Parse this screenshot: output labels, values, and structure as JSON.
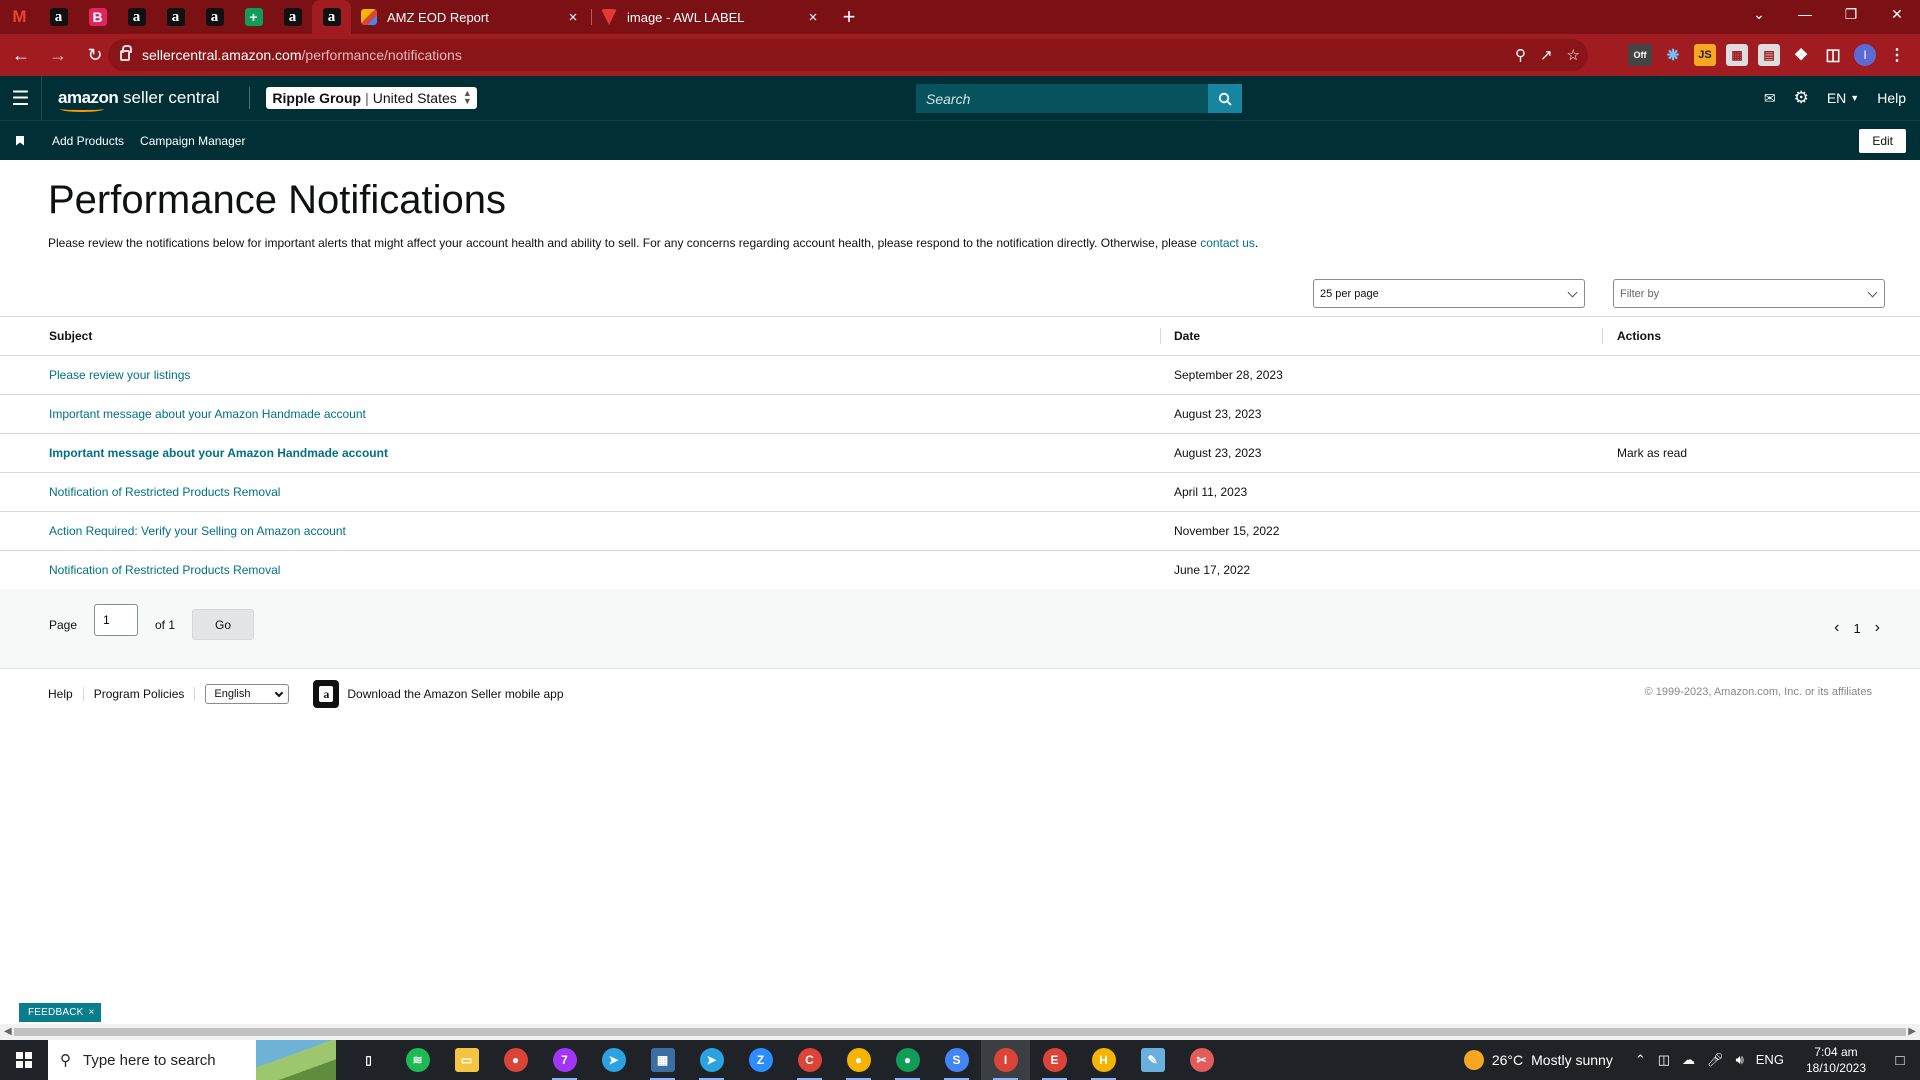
{
  "browser": {
    "pinned_tabs": [
      {
        "icon": "gmail-icon",
        "glyph": "M"
      },
      {
        "icon": "amazon-icon",
        "glyph": "a"
      },
      {
        "icon": "bold-b-icon",
        "glyph": "B"
      },
      {
        "icon": "amazon-icon",
        "glyph": "a"
      },
      {
        "icon": "amazon-icon",
        "glyph": "a"
      },
      {
        "icon": "amazon-icon",
        "glyph": "a"
      },
      {
        "icon": "sheets-icon",
        "glyph": "+"
      },
      {
        "icon": "amazon-icon",
        "glyph": "a"
      },
      {
        "icon": "amazon-icon",
        "glyph": "a"
      }
    ],
    "tabs": [
      {
        "title": "AMZ EOD Report",
        "icon": "report-icon"
      },
      {
        "title": "image - AWL LABEL",
        "icon": "awl-icon"
      }
    ],
    "url_domain": "sellercentral.amazon.com",
    "url_path": "/performance/notifications",
    "profile_initial": "I",
    "extension_off_badge": "Off",
    "extension_js": "JS",
    "colors": {
      "tab_strip": "#7b1114",
      "toolbar": "#a01c20"
    }
  },
  "header": {
    "logo_bold": "amazon",
    "logo_rest": " seller central",
    "account_name": "Ripple Group",
    "account_marketplace": "United States",
    "search_placeholder": "Search",
    "language": "EN",
    "help": "Help",
    "colors": {
      "bar": "#002f36",
      "search_button": "#1785a0"
    }
  },
  "bookmarks": {
    "links": [
      "Add Products",
      "Campaign Manager"
    ],
    "edit": "Edit"
  },
  "page": {
    "title": "Performance Notifications",
    "intro": "Please review the notifications below for important alerts that might affect your account health and ability to sell. For any concerns regarding account health, please respond to the notification directly. Otherwise, please ",
    "intro_link": "contact us",
    "intro_end": ".",
    "per_page": "25 per page",
    "filter_placeholder": "Filter by"
  },
  "table": {
    "headers": {
      "subject": "Subject",
      "date": "Date",
      "actions": "Actions"
    },
    "rows": [
      {
        "subject": "Please review your listings",
        "date": "September 28, 2023",
        "action": "",
        "unread": false
      },
      {
        "subject": "Important message about your Amazon Handmade account",
        "date": "August 23, 2023",
        "action": "",
        "unread": false
      },
      {
        "subject": "Important message about your Amazon Handmade account",
        "date": "August 23, 2023",
        "action": "Mark as read",
        "unread": true
      },
      {
        "subject": "Notification of Restricted Products Removal",
        "date": "April 11, 2023",
        "action": "",
        "unread": false
      },
      {
        "subject": "Action Required: Verify your Selling on Amazon account",
        "date": "November 15, 2022",
        "action": "",
        "unread": false
      },
      {
        "subject": "Notification of Restricted Products Removal",
        "date": "June 17, 2022",
        "action": "",
        "unread": false
      }
    ]
  },
  "pager": {
    "page_label": "Page",
    "page_value": "1",
    "of_label": "of 1",
    "go": "Go",
    "current": "1"
  },
  "footer": {
    "help": "Help",
    "policies": "Program Policies",
    "language": "English",
    "app_text": "Download the Amazon Seller mobile app",
    "copyright": "© 1999-2023, Amazon.com, Inc. or its affiliates"
  },
  "feedback": {
    "label": "FEEDBACK",
    "close": "×"
  },
  "taskbar": {
    "search_placeholder": "Type here to search",
    "weather_temp": "26°C",
    "weather_desc": "Mostly sunny",
    "lang": "ENG",
    "time": "7:04 am",
    "date": "18/10/2023",
    "apps": [
      {
        "name": "task-view-icon",
        "color": "#1f2226",
        "glyph": "▯",
        "open": false
      },
      {
        "name": "spotify-icon",
        "color": "#1db954",
        "glyph": "≋",
        "open": false
      },
      {
        "name": "file-explorer-icon",
        "color": "#f4c542",
        "glyph": "▭",
        "open": false
      },
      {
        "name": "chrome-icon",
        "color": "#db4437",
        "glyph": "●",
        "open": false
      },
      {
        "name": "messenger-icon",
        "color": "#a334fa",
        "glyph": "7",
        "open": true
      },
      {
        "name": "telegram-icon",
        "color": "#2aa3e0",
        "glyph": "➤",
        "open": false
      },
      {
        "name": "calculator-icon",
        "color": "#3a6ea5",
        "glyph": "▦",
        "open": true
      },
      {
        "name": "telegram-icon",
        "color": "#2aa3e0",
        "glyph": "➤",
        "open": true
      },
      {
        "name": "zoom-icon",
        "color": "#2d8cff",
        "glyph": "Z",
        "open": false
      },
      {
        "name": "chrome-profile-icon",
        "color": "#db4437",
        "glyph": "C",
        "open": true
      },
      {
        "name": "chrome-profile-icon",
        "color": "#f4b400",
        "glyph": "●",
        "open": true
      },
      {
        "name": "chrome-profile-icon",
        "color": "#0f9d58",
        "glyph": "●",
        "open": true
      },
      {
        "name": "chrome-profile-icon",
        "color": "#4285f4",
        "glyph": "S",
        "open": true
      },
      {
        "name": "chrome-profile-icon",
        "color": "#db4437",
        "glyph": "I",
        "open": true,
        "focus": true
      },
      {
        "name": "chrome-profile-icon",
        "color": "#db4437",
        "glyph": "E",
        "open": true
      },
      {
        "name": "chrome-profile-icon",
        "color": "#f4b400",
        "glyph": "H",
        "open": true
      },
      {
        "name": "notepad-icon",
        "color": "#6ab0de",
        "glyph": "✎",
        "open": false
      },
      {
        "name": "snip-tool-icon",
        "color": "#e25c5c",
        "glyph": "✂",
        "open": false
      }
    ]
  }
}
